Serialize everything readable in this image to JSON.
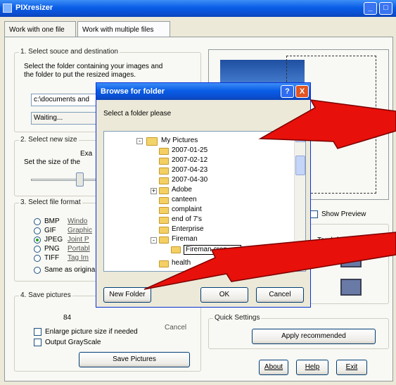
{
  "window": {
    "title": "PIXresizer"
  },
  "tabs": [
    {
      "label": "Work with one file"
    },
    {
      "label": "Work with multiple files"
    }
  ],
  "section1": {
    "title": "1. Select souce and destination",
    "desc1": "Select the folder containing your images and",
    "desc2": "the folder to put the resized images.",
    "source_value": "c:\\documents and",
    "status_value": "Waiting..."
  },
  "section2": {
    "title": "2. Select new size",
    "label_partial": "Exa",
    "desc": "Set the size of the"
  },
  "section3": {
    "title": "3. Select file format",
    "formats": [
      {
        "ext": "BMP",
        "desc": "Windo"
      },
      {
        "ext": "GIF",
        "desc": "Graphic"
      },
      {
        "ext": "JPEG",
        "desc": "Joint P"
      },
      {
        "ext": "PNG",
        "desc": "Portabl"
      },
      {
        "ext": "TIFF",
        "desc": "Tag Im"
      }
    ],
    "selected": "JPEG",
    "same_as_original": "Same as origina"
  },
  "section4": {
    "title": "4. Save pictures",
    "count": "84",
    "cancel": "Cancel",
    "enlarge": "Enlarge picture size if needed",
    "grayscale": "Output GrayScale",
    "save_button": "Save Pictures"
  },
  "preview": {
    "show_preview": "Show Preview",
    "position_label": "Top-left, top-lc"
  },
  "quick_settings": {
    "title": "Quick Settings",
    "apply_button": "Apply recommended"
  },
  "bottom_buttons": {
    "about": "About",
    "help": "Help",
    "exit": "Exit"
  },
  "dialog": {
    "title": "Browse for folder",
    "help_glyph": "?",
    "close_glyph": "X",
    "prompt": "Select a folder please",
    "tree": [
      {
        "label": "My Pictures",
        "expander": "-"
      },
      {
        "label": "2007-01-25"
      },
      {
        "label": "2007-02-12"
      },
      {
        "label": "2007-04-23"
      },
      {
        "label": "2007-04-30"
      },
      {
        "label": "Adobe",
        "expander": "+"
      },
      {
        "label": "canteen"
      },
      {
        "label": "complaint"
      },
      {
        "label": "end of 7's"
      },
      {
        "label": "Enterprise"
      },
      {
        "label": "Fireman",
        "expander": "-"
      },
      {
        "label": "Fireman crop"
      },
      {
        "label": "health"
      }
    ],
    "new_folder_button": "New Folder",
    "ok_button": "OK",
    "cancel_button": "Cancel"
  },
  "colors": {
    "arrow": "#e8100a",
    "titlebar": "#0a5de6",
    "accent_check": "#21a121"
  }
}
